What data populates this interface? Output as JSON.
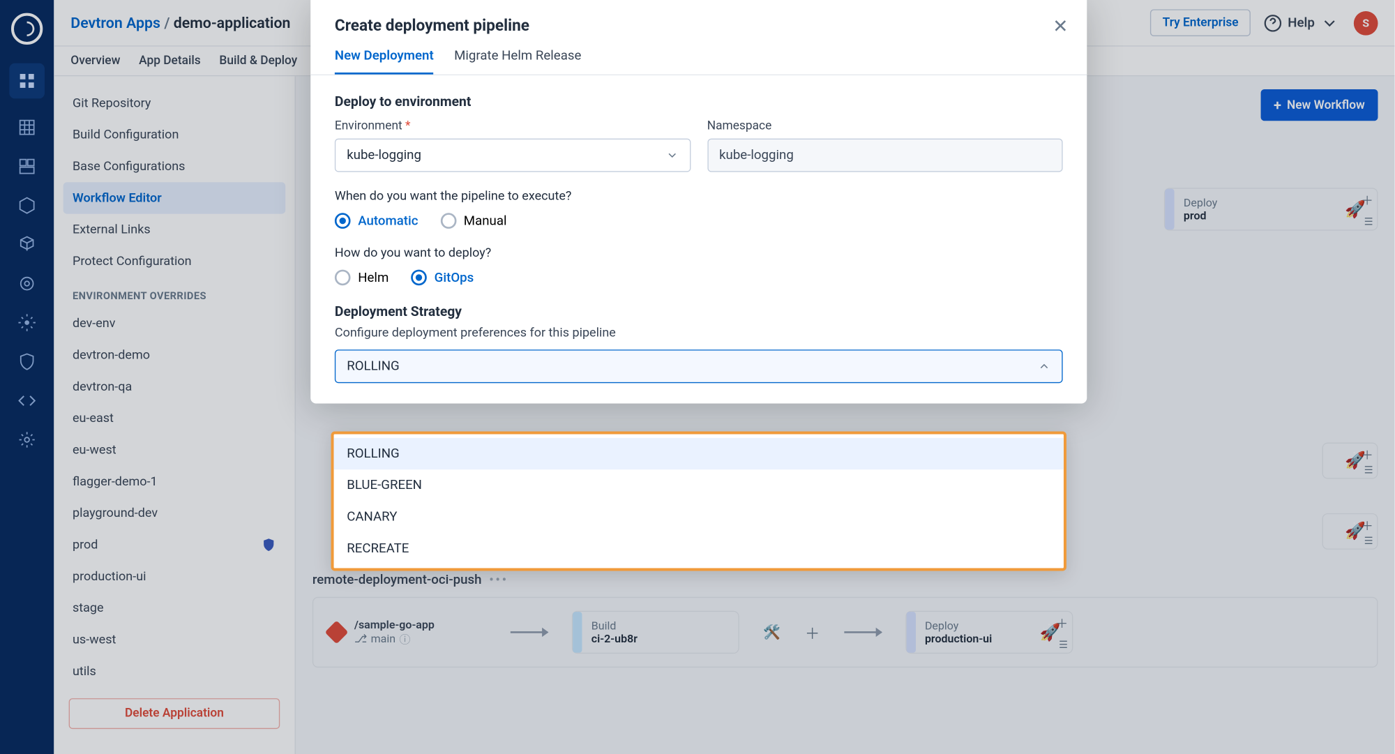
{
  "breadcrumb": {
    "parent": "Devtron Apps",
    "sep": "/",
    "current": "demo-application"
  },
  "topbar": {
    "try": "Try Enterprise",
    "help": "Help",
    "avatar": "S"
  },
  "subtabs": [
    "Overview",
    "App Details",
    "Build & Deploy"
  ],
  "confSidebar": {
    "items_top": [
      "Git Repository",
      "Build Configuration",
      "Base Configurations",
      "Workflow Editor",
      "External Links",
      "Protect Configuration"
    ],
    "active_index": 3,
    "section": "ENVIRONMENT OVERRIDES",
    "envs": [
      "dev-env",
      "devtron-demo",
      "devtron-qa",
      "eu-east",
      "eu-west",
      "flagger-demo-1",
      "playground-dev",
      "prod",
      "production-ui",
      "stage",
      "us-west",
      "utils"
    ],
    "shield_env_index": 7,
    "delete": "Delete Application"
  },
  "main": {
    "new_workflow": "New Workflow",
    "deploy_prod": {
      "label": "Deploy",
      "env": "prod"
    },
    "wf2_title": "remote-deployment-oci-push",
    "src": {
      "repo": "/sample-go-app",
      "branch": "main"
    },
    "build": {
      "label": "Build",
      "name": "ci-2-ub8r"
    },
    "deploy": {
      "label": "Deploy",
      "name": "production-ui"
    }
  },
  "modal": {
    "title": "Create deployment pipeline",
    "tabs": [
      "New Deployment",
      "Migrate Helm Release"
    ],
    "active_tab": 0,
    "section1": "Deploy to environment",
    "env_label": "Environment",
    "env_value": "kube-logging",
    "ns_label": "Namespace",
    "ns_value": "kube-logging",
    "exec_q": "When do you want the pipeline to execute?",
    "exec_opts": [
      "Automatic",
      "Manual"
    ],
    "exec_sel": 0,
    "deploy_q": "How do you want to deploy?",
    "deploy_opts": [
      "Helm",
      "GitOps"
    ],
    "deploy_sel": 1,
    "section2": "Deployment Strategy",
    "strat_sub": "Configure deployment preferences for this pipeline",
    "strat_value": "ROLLING",
    "strat_options": [
      "ROLLING",
      "BLUE-GREEN",
      "CANARY",
      "RECREATE"
    ],
    "strat_hl": 0
  }
}
